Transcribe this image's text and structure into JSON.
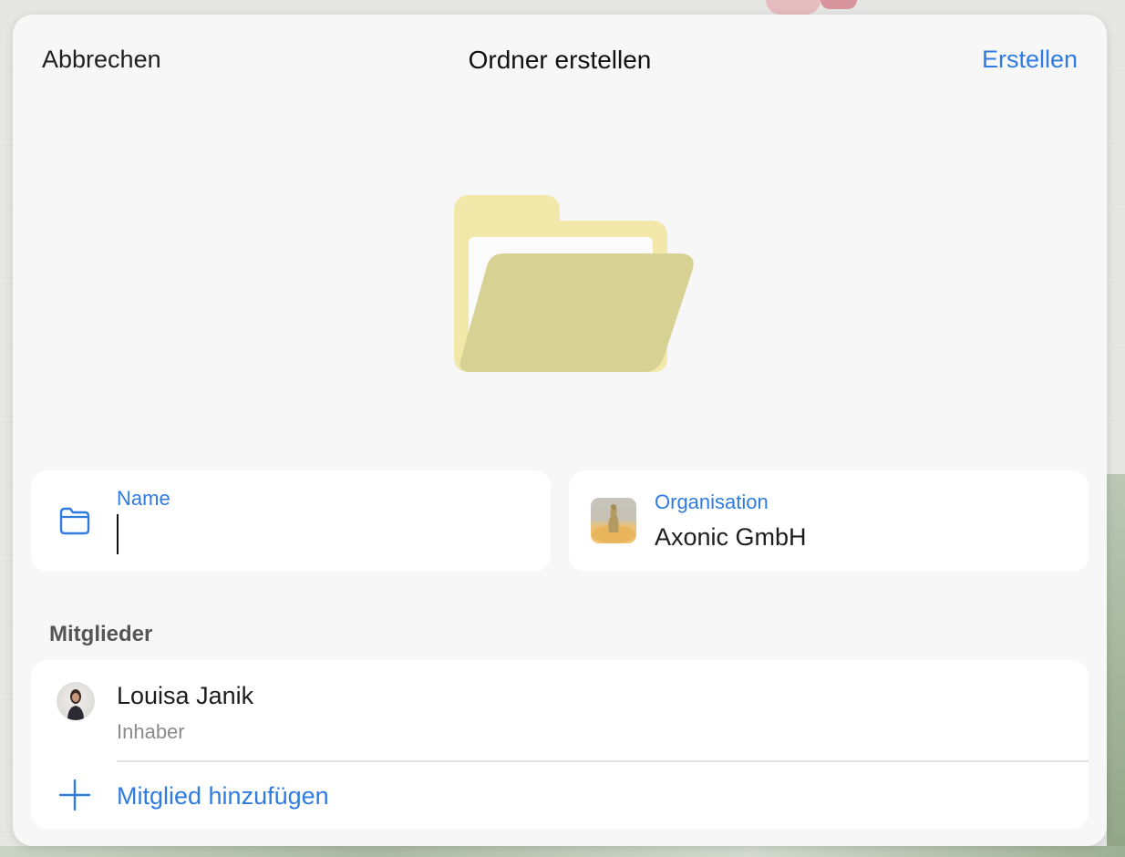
{
  "dialog": {
    "title": "Ordner erstellen",
    "cancel_label": "Abbrechen",
    "create_label": "Erstellen"
  },
  "folder_icon": "folder-open-icon",
  "name_field": {
    "label": "Name",
    "value": "",
    "icon": "folder-icon"
  },
  "organization": {
    "label": "Organisation",
    "value": "Axonic GmbH",
    "icon": "organization-avatar"
  },
  "members": {
    "section_title": "Mitglieder",
    "items": [
      {
        "name": "Louisa Janik",
        "role": "Inhaber"
      }
    ],
    "add_label": "Mitglied hinzufügen"
  },
  "colors": {
    "accent": "#2f7be0",
    "folder_back": "#f2e8a9",
    "folder_front": "#d7d194",
    "sheet_bg": "#f7f7f7",
    "card_bg": "#ffffff"
  }
}
